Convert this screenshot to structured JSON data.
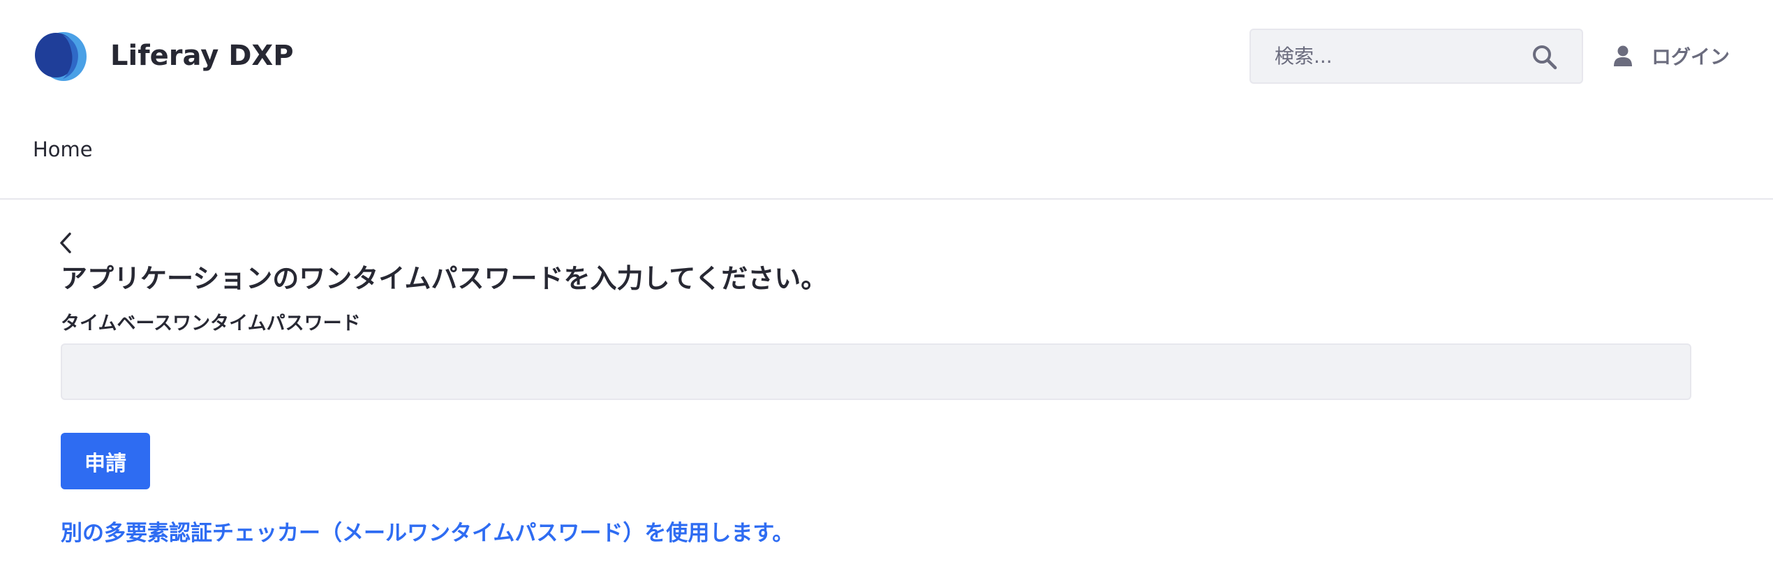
{
  "header": {
    "logo_icon": "liferay-logo-icon",
    "site_name": "Liferay DXP",
    "search": {
      "placeholder": "検索...",
      "value": "",
      "icon": "search-icon"
    },
    "login": {
      "icon": "user-icon",
      "label": "ログイン"
    }
  },
  "nav": {
    "items": [
      {
        "label": "Home"
      }
    ]
  },
  "main": {
    "back_icon": "chevron-left-icon",
    "title": "アプリケーションのワンタイムパスワードを入力してください。",
    "field": {
      "label": "タイムベースワンタイムパスワード",
      "value": ""
    },
    "submit_label": "申請",
    "alt_checker_link": "別の多要素認証チェッカー（メールワンタイムパスワード）を使用します。"
  },
  "colors": {
    "accent": "#2e6cf2",
    "text": "#272833",
    "muted": "#6b6c7e",
    "input_bg": "#f1f2f5",
    "border": "#e7e7ed",
    "logo_dark": "#1f3e99",
    "logo_light": "#4aa0e6"
  }
}
